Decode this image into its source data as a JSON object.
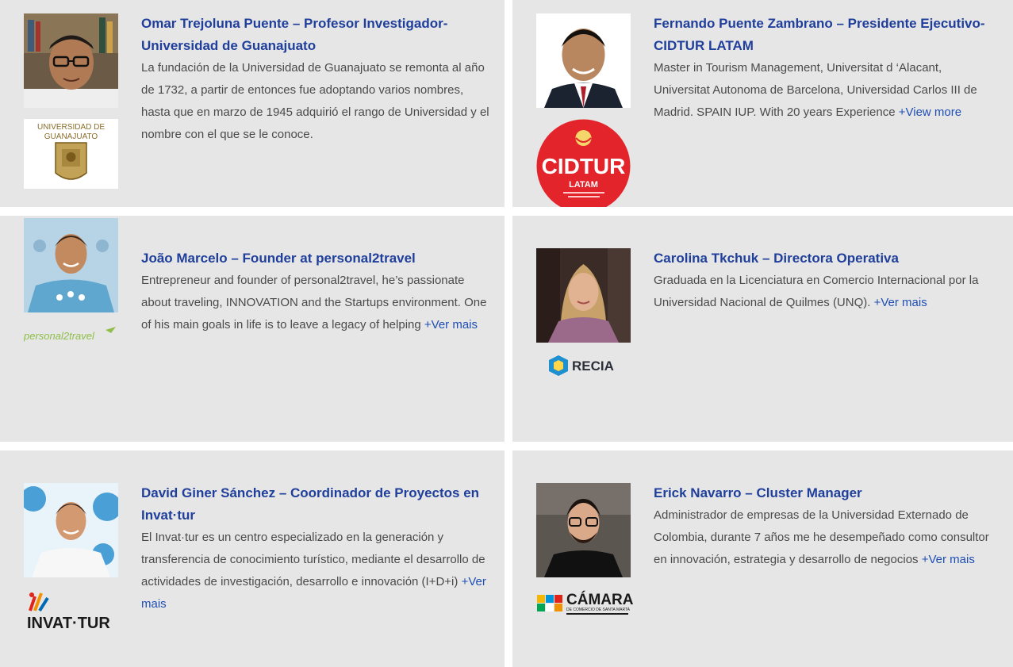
{
  "profiles": [
    {
      "name": "Omar Trejoluna Puente – Profesor Investigador- Universidad de Guanajuato",
      "description": "La fundación de la Universidad de Guanajuato se remonta al año de 1732, a partir de entonces fue adoptando varios nombres, hasta que en marzo de 1945 adquirió el rango de Universidad y el nombre con el que se le conoce.",
      "more": "",
      "logo_text": "UNIVERSIDAD DE GUANAJUATO"
    },
    {
      "name": "Fernando Puente Zambrano – Presidente Ejecutivo- CIDTUR LATAM",
      "description": "Master in Tourism Management, Universitat d ‘Alacant, Universitat Autonoma de Barcelona, Universidad Carlos III de Madrid. SPAIN IUP. With 20 years Experience",
      "more": "+View more",
      "logo_text": "CIDTUR",
      "logo_subtext": "LATAM"
    },
    {
      "name": "João Marcelo – Founder at personal2travel",
      "description": "Entrepreneur and founder of personal2travel, he’s passionate about traveling, INNOVATION and the Startups environment. One of his main goals in life is to leave a legacy of helping",
      "more": "+Ver mais",
      "logo_text": "personal2travel"
    },
    {
      "name": "Carolina Tkchuk – Directora Operativa",
      "description": "Graduada en la Licenciatura en Comercio Internacional por la Universidad Nacional de Quilmes (UNQ).",
      "more": "+Ver mais",
      "logo_text": "RECIA"
    },
    {
      "name": "David Giner Sánchez – Coordinador de Proyectos en Invat·tur",
      "description": "El Invat·tur es un centro especializado en la generación y transferencia de conocimiento turístico, mediante el desarrollo de actividades de investigación, desarrollo e innovación (I+D+i)",
      "more": "+Ver mais",
      "logo_text": "INVAT·TUR"
    },
    {
      "name": "Erick Navarro – Cluster Manager",
      "description": "Administrador de empresas de la Universidad Externado de Colombia, durante 7 años me he desempeñado como consultor en innovación, estrategia y desarrollo de negocios",
      "more": "+Ver mais",
      "logo_text": "CÁMARA",
      "logo_subtext": "DE COMERCIO DE SANTA MARTA"
    }
  ]
}
